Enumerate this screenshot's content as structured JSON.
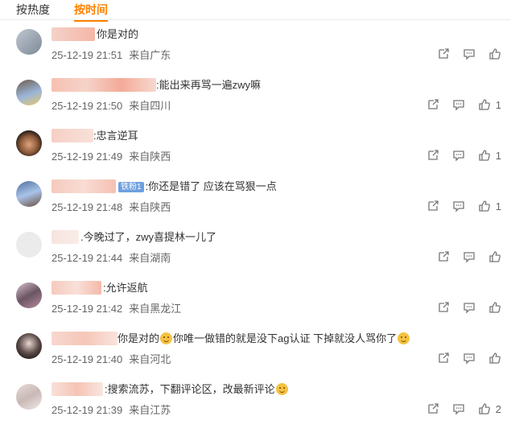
{
  "tabs": {
    "hot": "按热度",
    "time": "按时间"
  },
  "comments": [
    {
      "text": "你是对的",
      "time": "25-12-19 21:51",
      "loc": "来自广东",
      "likes": ""
    },
    {
      "text": ":能出来再骂一遍zwy嘛",
      "time": "25-12-19 21:50",
      "loc": "来自四川",
      "likes": "1"
    },
    {
      "text": ":忠言逆耳",
      "time": "25-12-19 21:49",
      "loc": "来自陕西",
      "likes": "1"
    },
    {
      "badge": "铁粉1",
      "text": ":你还是错了 应该在骂狠一点",
      "time": "25-12-19 21:48",
      "loc": "来自陕西",
      "likes": "1"
    },
    {
      "text": ".今晚过了，zwy喜提林一儿了",
      "time": "25-12-19 21:44",
      "loc": "来自湖南",
      "likes": ""
    },
    {
      "text": ":允许返航",
      "time": "25-12-19 21:42",
      "loc": "来自黑龙江",
      "likes": ""
    },
    {
      "text_a": "你是对的",
      "text_b": "你唯一做错的就是没下ag认证 下掉就没人骂你了",
      "time": "25-12-19 21:40",
      "loc": "来自河北",
      "likes": ""
    },
    {
      "text": ":搜索流苏，下翻评论区，改最新评论",
      "time": "25-12-19 21:39",
      "loc": "来自江苏",
      "likes": "2"
    }
  ],
  "colors": {
    "accent": "#ff8200",
    "meta": "#666666"
  },
  "icons": {
    "share": "share-icon",
    "comment": "comment-icon",
    "like": "thumbs-up-icon"
  }
}
